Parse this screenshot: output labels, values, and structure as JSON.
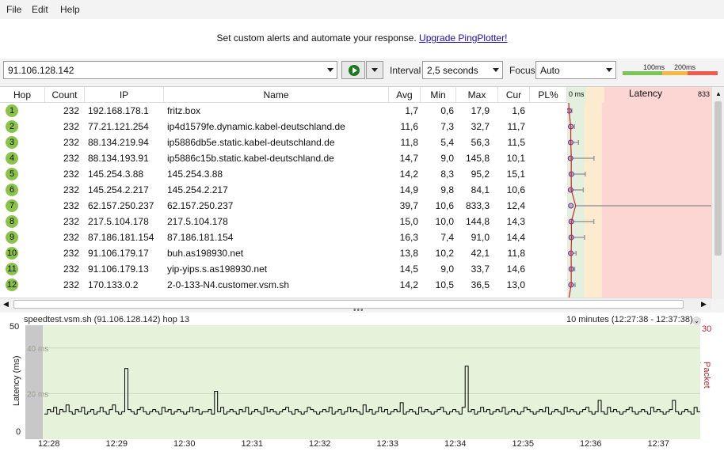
{
  "menu": [
    "File",
    "Edit",
    "Help"
  ],
  "banner": {
    "text": "Set custom alerts and automate your response.",
    "link": "Upgrade PingPlotter!"
  },
  "target": {
    "value": "91.106.128.142"
  },
  "interval": {
    "label": "Interval",
    "value": "2,5 seconds"
  },
  "focus": {
    "label": "Focus",
    "value": "Auto"
  },
  "latency_scale": {
    "a": "100ms",
    "b": "200ms",
    "colors": {
      "good": "#7cc45a",
      "warn": "#f5b843",
      "bad": "#f05a4f"
    }
  },
  "columns": [
    "Hop",
    "Count",
    "IP",
    "Name",
    "Avg",
    "Min",
    "Max",
    "Cur",
    "PL%"
  ],
  "latency_header": {
    "start": "0 ms",
    "title": "Latency",
    "end": "833"
  },
  "hops": [
    {
      "hop": "1",
      "count": "232",
      "ip": "192.168.178.1",
      "name": "fritz.box",
      "avg": "1,7",
      "min": "0,6",
      "max": "17,9",
      "cur": "1,6",
      "pl": ""
    },
    {
      "hop": "2",
      "count": "232",
      "ip": "77.21.121.254",
      "name": "ip4d1579fe.dynamic.kabel-deutschland.de",
      "avg": "11,6",
      "min": "7,3",
      "max": "32,7",
      "cur": "11,7",
      "pl": ""
    },
    {
      "hop": "3",
      "count": "232",
      "ip": "88.134.219.94",
      "name": "ip5886db5e.static.kabel-deutschland.de",
      "avg": "11,8",
      "min": "5,4",
      "max": "56,3",
      "cur": "11,5",
      "pl": ""
    },
    {
      "hop": "4",
      "count": "232",
      "ip": "88.134.193.91",
      "name": "ip5886c15b.static.kabel-deutschland.de",
      "avg": "14,7",
      "min": "9,0",
      "max": "145,8",
      "cur": "10,1",
      "pl": ""
    },
    {
      "hop": "5",
      "count": "232",
      "ip": "145.254.3.88",
      "name": "145.254.3.88",
      "avg": "14,2",
      "min": "8,3",
      "max": "95,2",
      "cur": "15,1",
      "pl": ""
    },
    {
      "hop": "6",
      "count": "232",
      "ip": "145.254.2.217",
      "name": "145.254.2.217",
      "avg": "14,9",
      "min": "9,8",
      "max": "84,1",
      "cur": "10,6",
      "pl": ""
    },
    {
      "hop": "7",
      "count": "232",
      "ip": "62.157.250.237",
      "name": "62.157.250.237",
      "avg": "39,7",
      "min": "10,6",
      "max": "833,3",
      "cur": "12,4",
      "pl": ""
    },
    {
      "hop": "8",
      "count": "232",
      "ip": "217.5.104.178",
      "name": "217.5.104.178",
      "avg": "15,0",
      "min": "10,0",
      "max": "144,8",
      "cur": "14,3",
      "pl": ""
    },
    {
      "hop": "9",
      "count": "232",
      "ip": "87.186.181.154",
      "name": "87.186.181.154",
      "avg": "16,3",
      "min": "7,4",
      "max": "91,0",
      "cur": "14,4",
      "pl": ""
    },
    {
      "hop": "10",
      "count": "232",
      "ip": "91.106.179.17",
      "name": "buh.as198930.net",
      "avg": "13,8",
      "min": "10,2",
      "max": "42,1",
      "cur": "11,8",
      "pl": ""
    },
    {
      "hop": "11",
      "count": "232",
      "ip": "91.106.179.13",
      "name": "yip-yips.s.as198930.net",
      "avg": "14,5",
      "min": "9,0",
      "max": "33,7",
      "cur": "14,6",
      "pl": ""
    },
    {
      "hop": "12",
      "count": "232",
      "ip": "170.133.0.2",
      "name": "2-0-133-N4.customer.vsm.sh",
      "avg": "14,2",
      "min": "10,5",
      "max": "36,5",
      "cur": "13,0",
      "pl": ""
    }
  ],
  "lower": {
    "title": "speedtest.vsm.sh (91.106.128.142) hop 13",
    "time_range": "10 minutes (12:27:38 - 12:37:38)",
    "y_left_max": "50",
    "y_left_min": "0",
    "y_right": "30",
    "ylabel": "Latency (ms)",
    "y2label": "Packet Loss %",
    "grid40": "40 ms",
    "grid20": "20 ms"
  },
  "chart_data": {
    "type": "line",
    "ylabel": "Latency (ms)",
    "y2label": "Packet Loss %",
    "ylim": [
      0,
      50
    ],
    "y2lim": [
      0,
      30
    ],
    "x_ticks": [
      "12:28",
      "12:29",
      "12:30",
      "12:31",
      "12:32",
      "12:33",
      "12:34",
      "12:35",
      "12:36",
      "12:37"
    ],
    "x_range": [
      "12:27:38",
      "12:37:38"
    ],
    "series": [
      {
        "values": [
          11,
          13,
          12,
          14,
          11,
          13,
          12,
          15,
          12,
          11,
          13,
          12,
          14,
          11,
          12,
          13,
          11,
          12,
          14,
          12,
          11,
          13,
          15,
          12,
          11,
          12,
          31,
          13,
          12,
          11,
          13,
          14,
          12,
          11,
          12,
          13,
          12,
          11,
          14,
          12,
          13,
          11,
          12,
          13,
          12,
          11,
          12,
          14,
          12,
          13,
          11,
          12,
          12,
          13,
          11,
          21,
          12,
          14,
          11,
          12,
          13,
          12,
          11,
          13,
          12,
          14,
          11,
          12,
          13,
          12,
          11,
          14,
          12,
          13,
          12,
          11,
          12,
          13,
          14,
          12,
          11,
          13,
          12,
          11,
          12,
          14,
          13,
          12,
          11,
          12,
          13,
          12,
          14,
          11,
          12,
          13,
          11,
          12,
          14,
          12,
          13,
          12,
          11,
          15,
          12,
          13,
          11,
          12,
          14,
          12,
          13,
          11,
          12,
          13,
          12,
          16,
          11,
          12,
          13,
          12,
          11,
          14,
          12,
          13,
          12,
          11,
          12,
          13,
          14,
          12,
          11,
          12,
          13,
          12,
          11,
          14,
          32,
          12,
          13,
          11,
          12,
          14,
          12,
          13,
          11,
          12,
          13,
          12,
          14,
          11,
          12,
          13,
          12,
          11,
          12,
          14,
          13,
          12,
          11,
          12,
          13,
          12,
          14,
          11,
          12,
          13,
          12,
          11,
          14,
          12,
          13,
          12,
          11,
          12,
          13,
          14,
          12,
          11,
          12,
          17,
          12,
          11,
          14,
          12,
          13,
          12,
          11,
          12,
          13,
          14,
          12,
          11,
          12,
          13,
          12,
          11,
          14,
          12,
          13,
          12,
          11,
          12,
          13,
          17,
          12,
          11,
          12,
          13,
          12,
          11,
          14,
          12
        ]
      }
    ]
  }
}
